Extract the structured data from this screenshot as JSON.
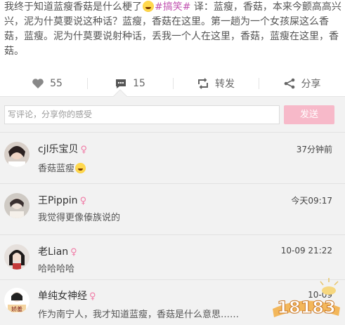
{
  "post": {
    "text_a": "我终于知道蓝瘦香菇是什么梗了",
    "tag": "#搞笑#",
    "text_b": " 译：蓝瘦，香菇，本来今颤高高兴兴，泥为什莫要说这种话？蓝瘦，香菇在这里。第一趟为一个女孩屎这么香菇，蓝瘦。泥为什莫要说射种话，丢我一个人在这里，香菇，蓝瘦在这里，香菇。"
  },
  "actions": {
    "likes": "55",
    "comments": "15",
    "repost_label": "转发",
    "share_label": "分享"
  },
  "compose": {
    "placeholder": "写评论，分享你的感受",
    "send_label": "发送"
  },
  "comments": [
    {
      "name": "cjl乐宝贝",
      "gender": "♀",
      "time": "37分钟前",
      "text": "香菇蓝瘦",
      "has_emoji": true
    },
    {
      "name": "王Pippin",
      "gender": "♀",
      "time": "今天09:17",
      "text": "我觉得更像傣族说的"
    },
    {
      "name": "老Lian",
      "gender": "♀",
      "time": "10-09 21:22",
      "text": "哈哈哈哈"
    },
    {
      "name": "单纯女神经",
      "gender": "♀",
      "time": "10-09",
      "text": "作为南宁人，我才知道蓝瘦，香菇是什么意思……"
    }
  ],
  "watermark": {
    "text": "18183"
  },
  "colors": {
    "accent_pink": "#f7b9c9",
    "gender_pink": "#f07aa5",
    "tag_purple": "#c153b0"
  }
}
